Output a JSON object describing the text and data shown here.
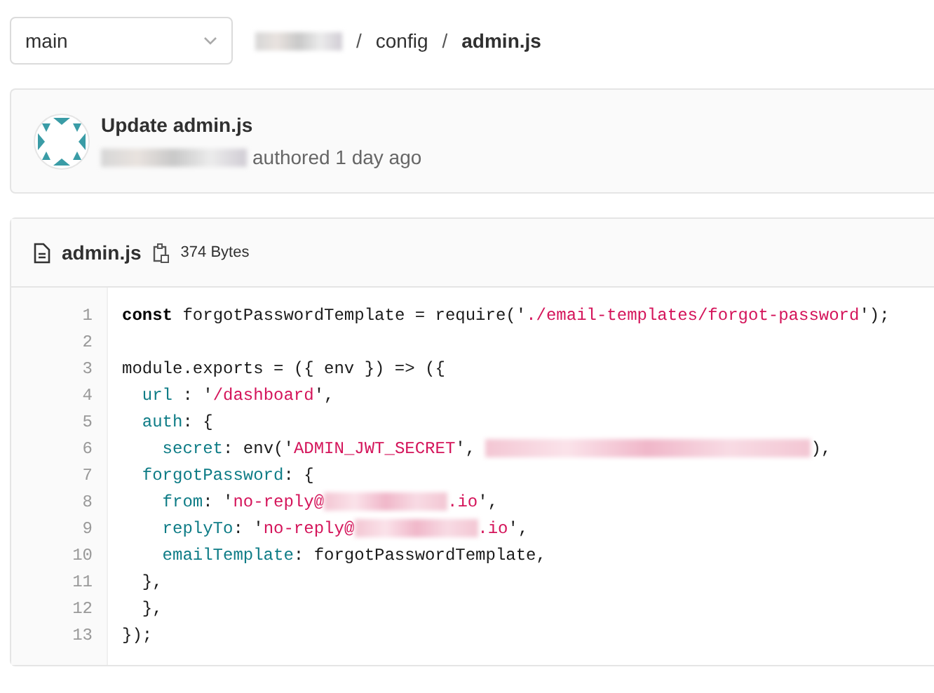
{
  "branch_select": {
    "value": "main"
  },
  "breadcrumb": [
    {
      "kind": "redaction"
    },
    {
      "kind": "link",
      "text": "config"
    },
    {
      "kind": "current",
      "text": "admin.js"
    }
  ],
  "breadcrumb_separator": "/",
  "commit": {
    "title": "Update admin.js",
    "author_redacted": true,
    "meta": "authored 1 day ago"
  },
  "file": {
    "name": "admin.js",
    "size": "374 Bytes"
  },
  "code_lines": [
    {
      "number": "1",
      "tokens": [
        {
          "kind": "keyword",
          "text": "const"
        },
        {
          "kind": "plain",
          "text": " forgotPasswordTemplate = require('"
        },
        {
          "kind": "string",
          "text": "./email-templates/forgot-password"
        },
        {
          "kind": "plain",
          "text": "');"
        }
      ]
    },
    {
      "number": "2"
    },
    {
      "number": "3",
      "tokens": [
        {
          "kind": "plain",
          "text": "module.exports = ({ env }) => ({"
        }
      ],
      "children": [
        {
          "number": "4",
          "tokens": [
            {
              "kind": "property",
              "text": "url"
            },
            {
              "kind": "plain",
              "text": " : '"
            },
            {
              "kind": "string",
              "text": "/dashboard"
            },
            {
              "kind": "plain",
              "text": "',"
            }
          ]
        },
        {
          "number": "5",
          "tokens": [
            {
              "kind": "property",
              "text": "auth"
            },
            {
              "kind": "plain",
              "text": ": {"
            }
          ],
          "children": [
            {
              "number": "6",
              "tokens": [
                {
                  "kind": "property",
                  "text": "secret"
                },
                {
                  "kind": "plain",
                  "text": ": env('"
                },
                {
                  "kind": "string",
                  "text": "ADMIN_JWT_SECRET"
                },
                {
                  "kind": "plain",
                  "text": "', "
                },
                {
                  "kind": "long_redaction"
                },
                {
                  "kind": "plain",
                  "text": "),"
                }
              ]
            }
          ]
        },
        {
          "number": "7",
          "tokens": [
            {
              "kind": "property",
              "text": "forgotPassword"
            },
            {
              "kind": "plain",
              "text": ": {"
            }
          ],
          "children": [
            {
              "number": "8",
              "tokens": [
                {
                  "kind": "property",
                  "text": "from"
                },
                {
                  "kind": "plain",
                  "text": ": '"
                },
                {
                  "kind": "string",
                  "text": "no-reply@"
                },
                {
                  "kind": "redaction"
                },
                {
                  "kind": "string",
                  "text": ".io"
                },
                {
                  "kind": "plain",
                  "text": "',"
                }
              ]
            },
            {
              "number": "9",
              "tokens": [
                {
                  "kind": "property",
                  "text": "replyTo"
                },
                {
                  "kind": "plain",
                  "text": ": '"
                },
                {
                  "kind": "string",
                  "text": "no-reply@"
                },
                {
                  "kind": "redaction"
                },
                {
                  "kind": "string",
                  "text": ".io"
                },
                {
                  "kind": "plain",
                  "text": "',"
                }
              ]
            },
            {
              "number": "10",
              "tokens": [
                {
                  "kind": "property",
                  "text": "emailTemplate"
                },
                {
                  "kind": "plain",
                  "text": ": forgotPasswordTemplate,"
                }
              ]
            }
          ]
        },
        {
          "number": "11",
          "tokens": [
            {
              "kind": "plain",
              "text": "},"
            }
          ]
        },
        {
          "number": "12",
          "tokens": [
            {
              "kind": "plain",
              "text": "},"
            }
          ]
        }
      ]
    },
    {
      "number": "13",
      "tokens": [
        {
          "kind": "plain",
          "text": "});"
        }
      ]
    }
  ]
}
